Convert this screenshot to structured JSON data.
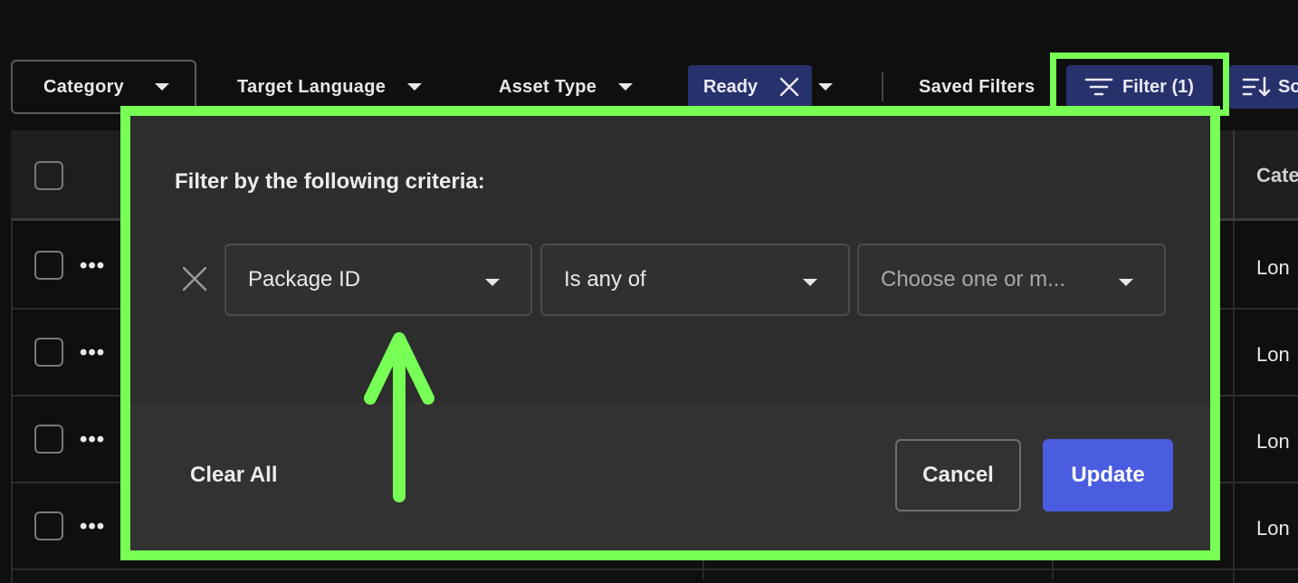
{
  "toolbar": {
    "category_label": "Category",
    "target_language_label": "Target Language",
    "asset_type_label": "Asset Type",
    "ready_chip_label": "Ready",
    "saved_filters_label": "Saved Filters",
    "filter_label": "Filter (1)",
    "sort_label": "So"
  },
  "table": {
    "category_header": "Cate",
    "rows": [
      {
        "category": "Lon"
      },
      {
        "category": "Lon"
      },
      {
        "category": "Lon"
      },
      {
        "category": "Lon"
      }
    ],
    "row_actions_glyph": "•••"
  },
  "filter_popover": {
    "title": "Filter by the following criteria:",
    "rule": {
      "field": "Package ID",
      "operator": "Is any of",
      "value_placeholder": "Choose one or m..."
    },
    "clear_all_label": "Clear All",
    "cancel_label": "Cancel",
    "update_label": "Update"
  },
  "colors": {
    "highlight": "#77ff55",
    "chip_bg": "#27316b",
    "primary": "#4a5de0",
    "background": "#0f0f0f"
  },
  "icons": [
    "chevron-down-icon",
    "close-icon",
    "filter-icon",
    "sort-icon",
    "more-horizontal-icon",
    "arrow-up-annotation"
  ]
}
